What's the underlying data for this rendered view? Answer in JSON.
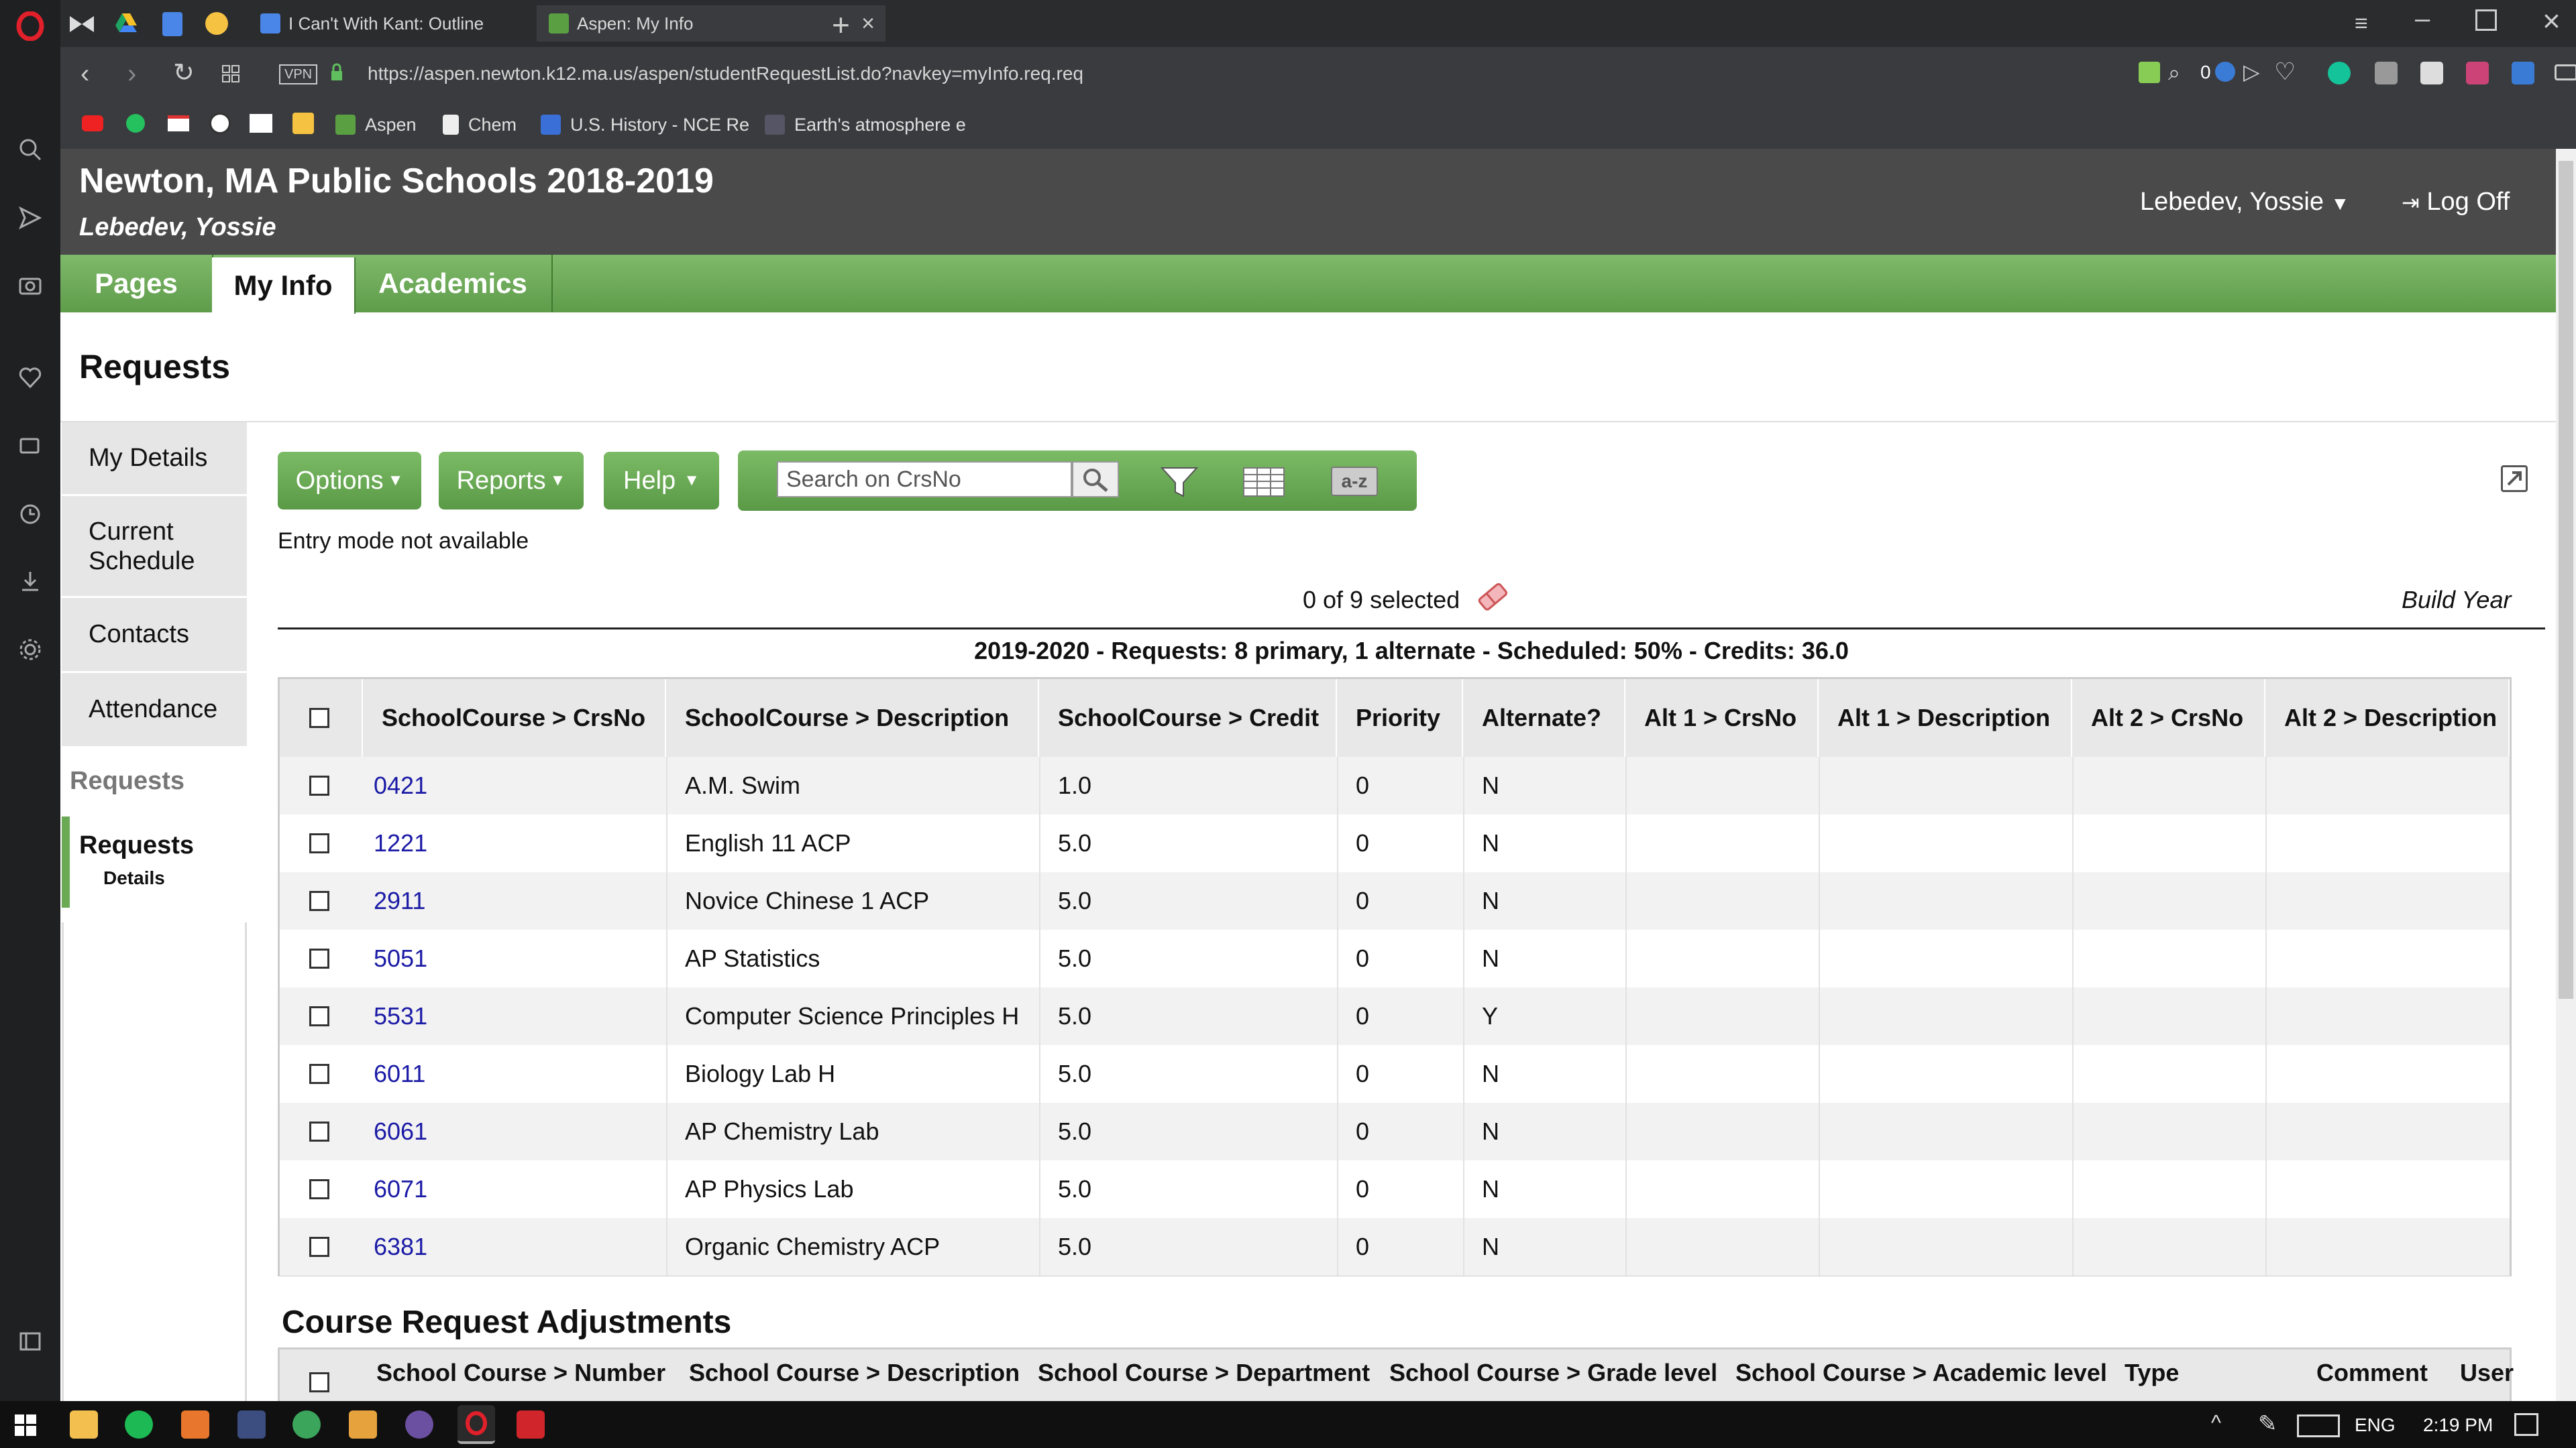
{
  "browser": {
    "tabs": [
      {
        "label": "I Can't With Kant: Outline",
        "icon": "docs-icon"
      },
      {
        "label": "Aspen: My Info",
        "icon": "aspen-icon",
        "active": true
      }
    ],
    "url": "https://aspen.newton.k12.ma.us/aspen/studentRequestList.do?navkey=myInfo.req.req",
    "vpn_label": "VPN",
    "ext_count": "0",
    "bookmarks": [
      {
        "label": "Aspen",
        "icon": "aspen-icon"
      },
      {
        "label": "Chem",
        "icon": "page-icon"
      },
      {
        "label": "U.S. History - NCE Re",
        "icon": "x-icon"
      },
      {
        "label": "Earth's atmosphere e",
        "icon": "image-icon"
      }
    ]
  },
  "app": {
    "school": "Newton, MA Public Schools 2018-2019",
    "student": "Lebedev, Yossie",
    "user_menu": "Lebedev, Yossie",
    "logoff": "Log Off",
    "nav": [
      "Pages",
      "My Info",
      "Academics"
    ],
    "page_title": "Requests"
  },
  "sidebar": {
    "items": [
      "My Details",
      "Current Schedule",
      "Contacts",
      "Attendance"
    ],
    "section": "Requests",
    "sub_active": "Requests",
    "sub_active_child": "Details"
  },
  "toolbar": {
    "options": "Options",
    "reports": "Reports",
    "help": "Help",
    "search_placeholder": "Search on CrsNo",
    "sort_label": "a-z",
    "entry_mode": "Entry mode not available",
    "selected": "0 of 9 selected",
    "build_year": "Build Year",
    "summary": "2019-2020 - Requests: 8 primary, 1 alternate - Scheduled: 50% - Credits: 36.0"
  },
  "table": {
    "headers": [
      "SchoolCourse > CrsNo",
      "SchoolCourse > Description",
      "SchoolCourse > Credit",
      "Priority",
      "Alternate?",
      "Alt 1 > CrsNo",
      "Alt 1 > Description",
      "Alt 2 > CrsNo",
      "Alt 2 > Description"
    ],
    "rows": [
      {
        "crsno": "0421",
        "desc": "A.M. Swim",
        "credit": "1.0",
        "priority": "0",
        "alt": "N"
      },
      {
        "crsno": "1221",
        "desc": "English 11 ACP",
        "credit": "5.0",
        "priority": "0",
        "alt": "N"
      },
      {
        "crsno": "2911",
        "desc": "Novice Chinese 1 ACP",
        "credit": "5.0",
        "priority": "0",
        "alt": "N"
      },
      {
        "crsno": "5051",
        "desc": "AP Statistics",
        "credit": "5.0",
        "priority": "0",
        "alt": "N"
      },
      {
        "crsno": "5531",
        "desc": "Computer Science Principles H",
        "credit": "5.0",
        "priority": "0",
        "alt": "Y"
      },
      {
        "crsno": "6011",
        "desc": "Biology Lab H",
        "credit": "5.0",
        "priority": "0",
        "alt": "N"
      },
      {
        "crsno": "6061",
        "desc": "AP Chemistry Lab",
        "credit": "5.0",
        "priority": "0",
        "alt": "N"
      },
      {
        "crsno": "6071",
        "desc": "AP Physics Lab",
        "credit": "5.0",
        "priority": "0",
        "alt": "N"
      },
      {
        "crsno": "6381",
        "desc": "Organic Chemistry ACP",
        "credit": "5.0",
        "priority": "0",
        "alt": "N"
      }
    ]
  },
  "adjustments": {
    "title": "Course Request Adjustments",
    "headers": [
      "School Course > Number",
      "School Course > Description",
      "School Course > Department",
      "School Course > Grade level",
      "School Course > Academic level",
      "Type",
      "Comment",
      "User"
    ]
  },
  "taskbar": {
    "lang": "ENG",
    "time": "2:19 PM"
  },
  "colors": {
    "accent_green": "#6aaa55",
    "header_gray": "#4a4a4a",
    "link_blue": "#1a1aa6"
  }
}
